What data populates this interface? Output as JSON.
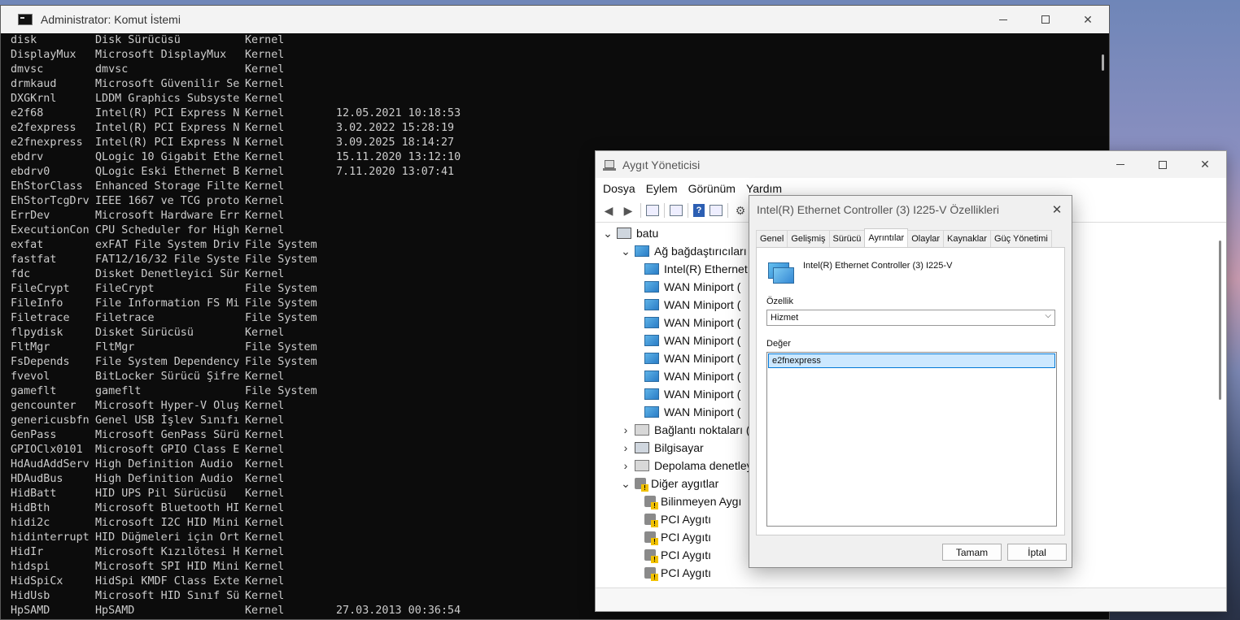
{
  "cmd": {
    "title": "Administrator: Komut İstemi",
    "rows": [
      [
        "disk",
        "Disk Sürücüsü",
        "Kernel",
        ""
      ],
      [
        "DisplayMux",
        "Microsoft DisplayMux",
        "Kernel",
        ""
      ],
      [
        "dmvsc",
        "dmvsc",
        "Kernel",
        ""
      ],
      [
        "drmkaud",
        "Microsoft Güvenilir Se",
        "Kernel",
        ""
      ],
      [
        "DXGKrnl",
        "LDDM Graphics Subsyste",
        "Kernel",
        ""
      ],
      [
        "e2f68",
        "Intel(R) PCI Express N",
        "Kernel",
        "12.05.2021 10:18:53"
      ],
      [
        "e2fexpress",
        "Intel(R) PCI Express N",
        "Kernel",
        "3.02.2022 15:28:19"
      ],
      [
        "e2fnexpress",
        "Intel(R) PCI Express N",
        "Kernel",
        "3.09.2025 18:14:27"
      ],
      [
        "ebdrv",
        "QLogic 10 Gigabit Ethe",
        "Kernel",
        "15.11.2020 13:12:10"
      ],
      [
        "ebdrv0",
        "QLogic Eski Ethernet B",
        "Kernel",
        "7.11.2020 13:07:41"
      ],
      [
        "EhStorClass",
        "Enhanced Storage Filte",
        "Kernel",
        ""
      ],
      [
        "EhStorTcgDrv",
        "IEEE 1667 ve TCG proto",
        "Kernel",
        ""
      ],
      [
        "ErrDev",
        "Microsoft Hardware Err",
        "Kernel",
        ""
      ],
      [
        "ExecutionCon",
        "CPU Scheduler for High",
        "Kernel",
        ""
      ],
      [
        "exfat",
        "exFAT File System Driv",
        "File System",
        ""
      ],
      [
        "fastfat",
        "FAT12/16/32 File Syste",
        "File System",
        ""
      ],
      [
        "fdc",
        "Disket Denetleyici Sür",
        "Kernel",
        ""
      ],
      [
        "FileCrypt",
        "FileCrypt",
        "File System",
        ""
      ],
      [
        "FileInfo",
        "File Information FS Mi",
        "File System",
        ""
      ],
      [
        "Filetrace",
        "Filetrace",
        "File System",
        ""
      ],
      [
        "flpydisk",
        "Disket Sürücüsü",
        "Kernel",
        ""
      ],
      [
        "FltMgr",
        "FltMgr",
        "File System",
        ""
      ],
      [
        "FsDepends",
        "File System Dependency",
        "File System",
        ""
      ],
      [
        "fvevol",
        "BitLocker Sürücü Şifre",
        "Kernel",
        ""
      ],
      [
        "gameflt",
        "gameflt",
        "File System",
        ""
      ],
      [
        "gencounter",
        "Microsoft Hyper-V Oluş",
        "Kernel",
        ""
      ],
      [
        "genericusbfn",
        "Genel USB İşlev Sınıfı",
        "Kernel",
        ""
      ],
      [
        "GenPass",
        "Microsoft GenPass Sürü",
        "Kernel",
        ""
      ],
      [
        "GPIOClx0101",
        "Microsoft GPIO Class E",
        "Kernel",
        ""
      ],
      [
        "HdAudAddServ",
        "High Definition Audio",
        "Kernel",
        ""
      ],
      [
        "HDAudBus",
        "High Definition Audio",
        "Kernel",
        ""
      ],
      [
        "HidBatt",
        "HID UPS Pil Sürücüsü",
        "Kernel",
        ""
      ],
      [
        "HidBth",
        "Microsoft Bluetooth HI",
        "Kernel",
        ""
      ],
      [
        "hidi2c",
        "Microsoft I2C HID Mini",
        "Kernel",
        ""
      ],
      [
        "hidinterrupt",
        "HID Düğmeleri için Ort",
        "Kernel",
        ""
      ],
      [
        "HidIr",
        "Microsoft Kızılötesi H",
        "Kernel",
        ""
      ],
      [
        "hidspi",
        "Microsoft SPI HID Mini",
        "Kernel",
        ""
      ],
      [
        "HidSpiCx",
        "HidSpi KMDF Class Exte",
        "Kernel",
        ""
      ],
      [
        "HidUsb",
        "Microsoft HID Sınıf Sü",
        "Kernel",
        ""
      ],
      [
        "HpSAMD",
        "HpSAMD",
        "Kernel",
        "27.03.2013 00:36:54"
      ]
    ]
  },
  "devmgr": {
    "title": "Aygıt Yöneticisi",
    "menu": [
      "Dosya",
      "Eylem",
      "Görünüm",
      "Yardım"
    ],
    "tree": [
      {
        "label": "batu",
        "level": 0,
        "chev": "expanded",
        "icon": "computer-icon"
      },
      {
        "label": "Ağ bağdaştırıcıları",
        "level": 1,
        "chev": "expanded",
        "icon": "network-adapter-icon"
      },
      {
        "label": "Intel(R) Ethernet",
        "level": 2,
        "chev": "none",
        "icon": "network-adapter-icon"
      },
      {
        "label": "WAN Miniport (",
        "level": 2,
        "chev": "none",
        "icon": "network-adapter-icon"
      },
      {
        "label": "WAN Miniport (",
        "level": 2,
        "chev": "none",
        "icon": "network-adapter-icon"
      },
      {
        "label": "WAN Miniport (",
        "level": 2,
        "chev": "none",
        "icon": "network-adapter-icon"
      },
      {
        "label": "WAN Miniport (",
        "level": 2,
        "chev": "none",
        "icon": "network-adapter-icon"
      },
      {
        "label": "WAN Miniport (",
        "level": 2,
        "chev": "none",
        "icon": "network-adapter-icon"
      },
      {
        "label": "WAN Miniport (",
        "level": 2,
        "chev": "none",
        "icon": "network-adapter-icon"
      },
      {
        "label": "WAN Miniport (",
        "level": 2,
        "chev": "none",
        "icon": "network-adapter-icon"
      },
      {
        "label": "WAN Miniport (",
        "level": 2,
        "chev": "none",
        "icon": "network-adapter-icon"
      },
      {
        "label": "Bağlantı noktaları (C",
        "level": 1,
        "chev": "collapsed",
        "icon": "port-icon"
      },
      {
        "label": "Bilgisayar",
        "level": 1,
        "chev": "collapsed",
        "icon": "computer-icon"
      },
      {
        "label": "Depolama denetley",
        "level": 1,
        "chev": "collapsed",
        "icon": "storage-icon"
      },
      {
        "label": "Diğer aygıtlar",
        "level": 1,
        "chev": "expanded",
        "icon": "warning-device-icon"
      },
      {
        "label": "Bilinmeyen Aygı",
        "level": 2,
        "chev": "none",
        "icon": "warning-device-icon"
      },
      {
        "label": "PCI Aygıtı",
        "level": 2,
        "chev": "none",
        "icon": "warning-device-icon"
      },
      {
        "label": "PCI Aygıtı",
        "level": 2,
        "chev": "none",
        "icon": "warning-device-icon"
      },
      {
        "label": "PCI Aygıtı",
        "level": 2,
        "chev": "none",
        "icon": "warning-device-icon"
      },
      {
        "label": "PCI Aygıtı",
        "level": 2,
        "chev": "none",
        "icon": "warning-device-icon"
      }
    ]
  },
  "props": {
    "title": "Intel(R) Ethernet Controller (3) I225-V Özellikleri",
    "tabs": [
      "Genel",
      "Gelişmiş",
      "Sürücü",
      "Ayrıntılar",
      "Olaylar",
      "Kaynaklar",
      "Güç Yönetimi"
    ],
    "active_tab": "Ayrıntılar",
    "device_name": "Intel(R) Ethernet Controller (3) I225-V",
    "property_label": "Özellik",
    "property_value": "Hizmet",
    "value_label": "Değer",
    "value_item": "e2fnexpress",
    "ok": "Tamam",
    "cancel": "İptal"
  }
}
